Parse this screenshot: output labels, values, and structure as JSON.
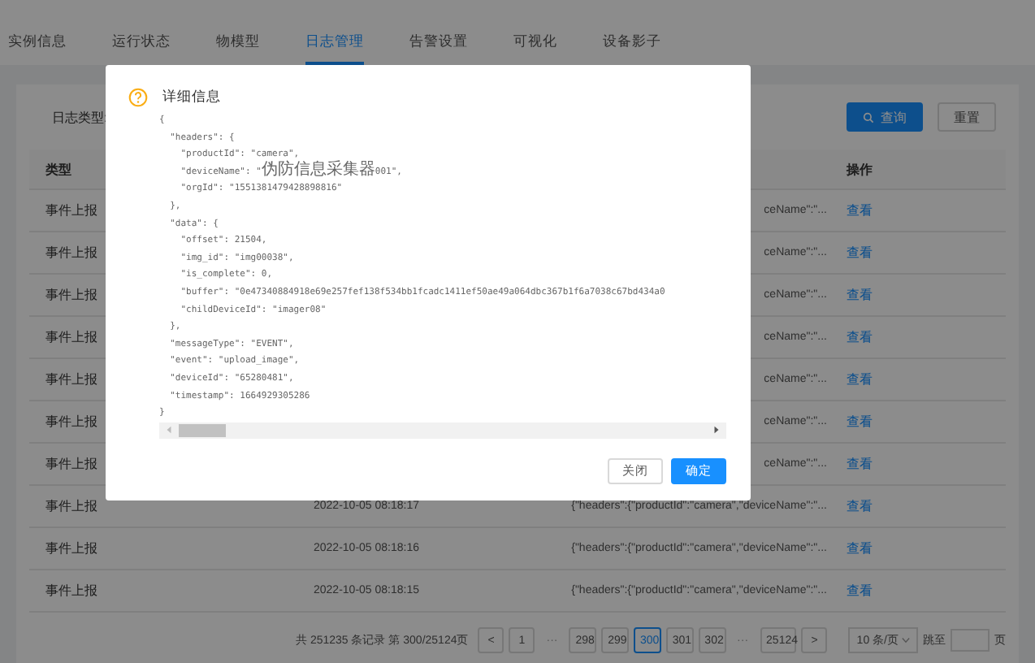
{
  "tabs": [
    {
      "label": "实例信息",
      "selected": false
    },
    {
      "label": "运行状态",
      "selected": false
    },
    {
      "label": "物模型",
      "selected": false
    },
    {
      "label": "日志管理",
      "selected": true
    },
    {
      "label": "告警设置",
      "selected": false
    },
    {
      "label": "可视化",
      "selected": false
    },
    {
      "label": "设备影子",
      "selected": false
    }
  ],
  "filter": {
    "label": "日志类型:",
    "search_button": "查询",
    "reset_button": "重置"
  },
  "table": {
    "columns": [
      "类型",
      "操作"
    ],
    "rows": [
      {
        "type": "事件上报",
        "content": "ceName\":\"...",
        "action": "查看"
      },
      {
        "type": "事件上报",
        "content": "ceName\":\"...",
        "action": "查看"
      },
      {
        "type": "事件上报",
        "content": "ceName\":\"...",
        "action": "查看"
      },
      {
        "type": "事件上报",
        "content": "ceName\":\"...",
        "action": "查看"
      },
      {
        "type": "事件上报",
        "content": "ceName\":\"...",
        "action": "查看"
      },
      {
        "type": "事件上报",
        "content": "ceName\":\"...",
        "action": "查看"
      },
      {
        "type": "事件上报",
        "content": "ceName\":\"...",
        "action": "查看"
      },
      {
        "type": "事件上报",
        "time": "2022-10-05 08:18:17",
        "content": "{\"headers\":{\"productId\":\"camera\",\"deviceName\":\"...",
        "action": "查看"
      },
      {
        "type": "事件上报",
        "time": "2022-10-05 08:18:16",
        "content": "{\"headers\":{\"productId\":\"camera\",\"deviceName\":\"...",
        "action": "查看"
      },
      {
        "type": "事件上报",
        "time": "2022-10-05 08:18:15",
        "content": "{\"headers\":{\"productId\":\"camera\",\"deviceName\":\"...",
        "action": "查看"
      }
    ]
  },
  "pagination": {
    "summary": "共 251235 条记录 第 300/25124页",
    "prev": "<",
    "next": ">",
    "pages": [
      {
        "label": "1",
        "selected": false
      },
      {
        "label": "···",
        "selected": false
      },
      {
        "label": "298",
        "selected": false
      },
      {
        "label": "299",
        "selected": false
      },
      {
        "label": "300",
        "selected": true
      },
      {
        "label": "301",
        "selected": false
      },
      {
        "label": "302",
        "selected": false
      },
      {
        "label": "···",
        "selected": false
      },
      {
        "label": "25124",
        "selected": false
      }
    ],
    "page_size": "10 条/页",
    "jump_label": "跳至",
    "jump_suffix": "页"
  },
  "modal": {
    "title": "详细信息",
    "lines": [
      "{",
      "  \"headers\": {",
      "    \"productId\": \"camera\",",
      "    \"deviceName\": \"伪防信息采集器001\",",
      "    \"orgId\": \"1551381479428898816\"",
      "  },",
      "  \"data\": {",
      "    \"offset\": 21504,",
      "    \"img_id\": \"img00038\",",
      "    \"is_complete\": 0,",
      "    \"buffer\": \"0e47340884918e69e257fef138f534bb1fcadc1411ef50ae49a064dbc367b1f6a7038c67bd434a0",
      "    \"childDeviceId\": \"imager08\"",
      "  },",
      "  \"messageType\": \"EVENT\",",
      "  \"event\": \"upload_image\",",
      "  \"deviceId\": \"65280481\",",
      "  \"timestamp\": 1664929305286",
      "}"
    ],
    "buttons": [
      {
        "label": "关闭",
        "kind": "default"
      },
      {
        "label": "确定",
        "kind": "primary"
      }
    ]
  }
}
